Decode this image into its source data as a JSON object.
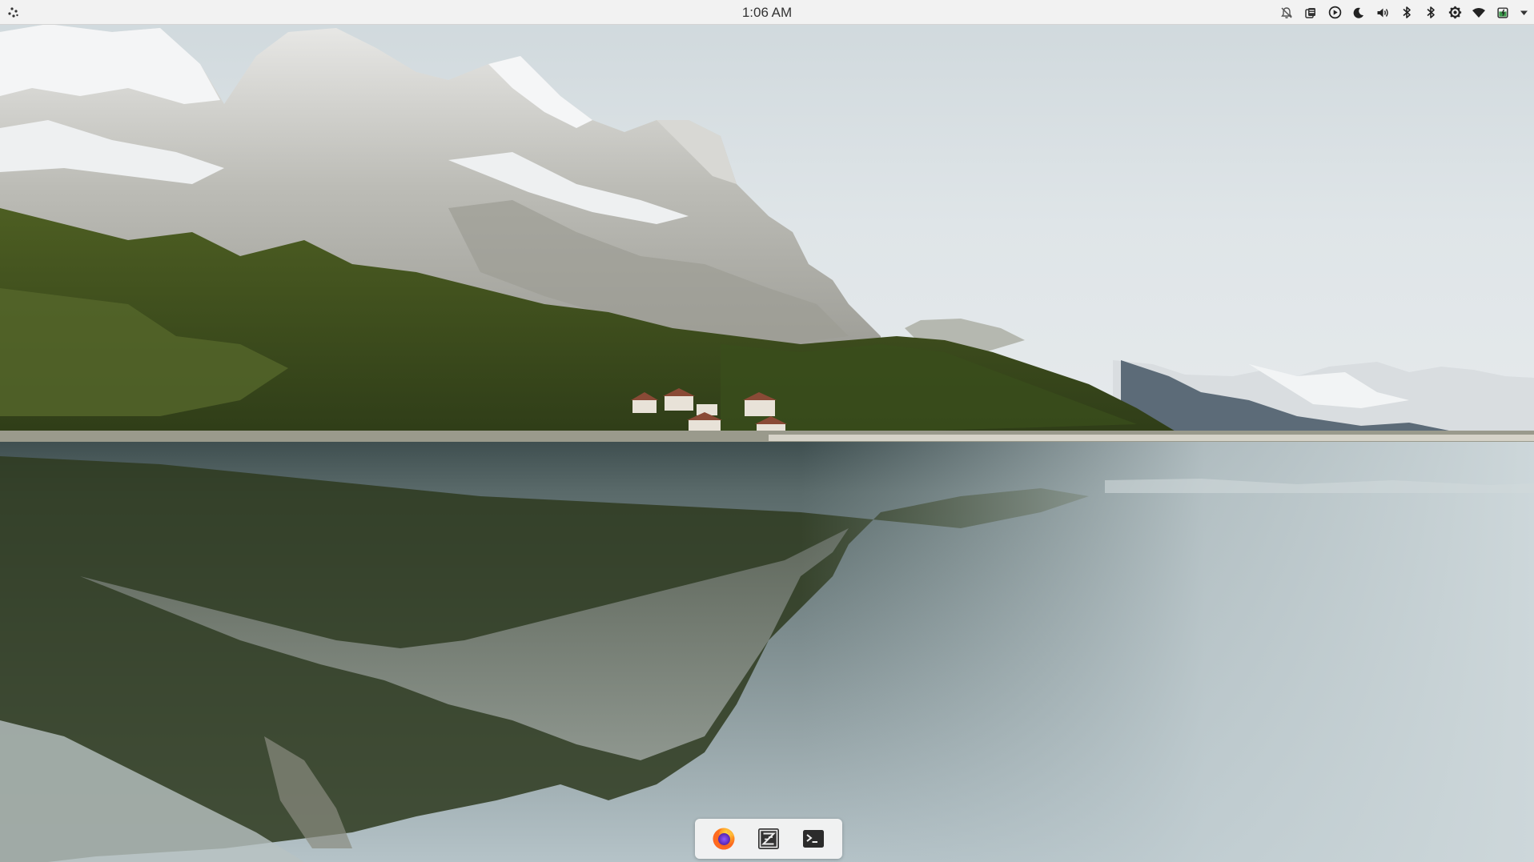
{
  "top_panel": {
    "clock_text": "1:06 AM",
    "launcher_icon": "app-launcher-icon",
    "tray_icons": [
      "notifications-off-icon",
      "clipboard-icon",
      "media-play-icon",
      "night-mode-icon",
      "volume-icon",
      "bluetooth-icon",
      "bluetooth-secondary-icon",
      "settings-gear-icon",
      "wifi-icon",
      "battery-icon",
      "chevron-down-icon"
    ]
  },
  "dock": {
    "items": [
      {
        "name": "firefox",
        "icon": "firefox-icon"
      },
      {
        "name": "zed-editor",
        "icon": "zed-editor-icon"
      },
      {
        "name": "terminal",
        "icon": "terminal-icon"
      }
    ]
  },
  "wallpaper": {
    "scene": "mountain-lake-reflection"
  },
  "colors": {
    "panel_bg": "#f2f2f2",
    "panel_text": "#333333",
    "dock_bg": "#f5f5f5",
    "battery_accent": "#3a9a4a"
  }
}
